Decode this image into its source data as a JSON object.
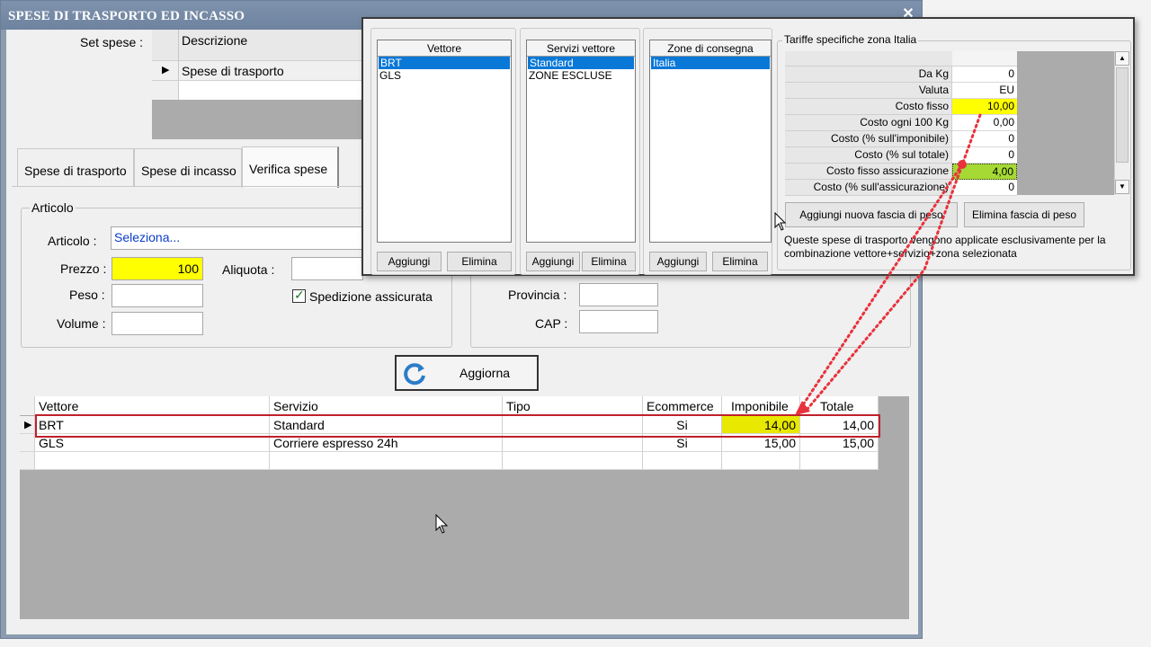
{
  "window": {
    "title": "SPESE DI TRASPORTO ED INCASSO",
    "close_glyph": "✕"
  },
  "set_spese": {
    "label": "Set spese :",
    "column_header": "Descrizione",
    "rows": [
      "Spese di trasporto",
      ""
    ]
  },
  "tabs": [
    "Spese di trasporto",
    "Spese di incasso",
    "Verifica spese"
  ],
  "articolo": {
    "group_title": "Articolo",
    "articolo_label": "Articolo :",
    "articolo_value": "Seleziona...",
    "prezzo_label": "Prezzo :",
    "prezzo_value": "100",
    "aliquota_label": "Aliquota :",
    "aliquota_value": "",
    "peso_label": "Peso :",
    "peso_value": "",
    "volume_label": "Volume :",
    "volume_value": "",
    "spedizione_label": "Spedizione assicurata",
    "spedizione_checked": true
  },
  "destinazione": {
    "provincia_label": "Provincia :",
    "provincia_value": "",
    "cap_label": "CAP :",
    "cap_value": ""
  },
  "aggiorna_button": "Aggiorna",
  "results": {
    "columns": [
      "Vettore",
      "Servizio",
      "Tipo",
      "Ecommerce",
      "Imponibile",
      "Totale"
    ],
    "rows": [
      {
        "vettore": "BRT",
        "servizio": "Standard",
        "tipo": "",
        "ecommerce": "Si",
        "imponibile": "14,00",
        "totale": "14,00"
      },
      {
        "vettore": "GLS",
        "servizio": "Corriere espresso 24h",
        "tipo": "",
        "ecommerce": "Si",
        "imponibile": "15,00",
        "totale": "15,00"
      }
    ]
  },
  "popup": {
    "vettore": {
      "header": "Vettore",
      "items": [
        "BRT",
        "GLS"
      ],
      "selected": "BRT",
      "add": "Aggiungi",
      "remove": "Elimina"
    },
    "servizi": {
      "header": "Servizi vettore",
      "items": [
        "Standard",
        "ZONE ESCLUSE"
      ],
      "selected": "Standard",
      "add": "Aggiungi",
      "remove": "Elimina"
    },
    "zone": {
      "header": "Zone di consegna",
      "items": [
        "Italia"
      ],
      "selected": "Italia",
      "add": "Aggiungi",
      "remove": "Elimina"
    },
    "tariffe": {
      "title": "Tariffe specifiche zona Italia",
      "rows": [
        {
          "key": "Da Kg",
          "value": "0"
        },
        {
          "key": "Valuta",
          "value": "EU"
        },
        {
          "key": "Costo fisso",
          "value": "10,00"
        },
        {
          "key": "Costo ogni 100 Kg",
          "value": "0,00"
        },
        {
          "key": "Costo (% sull'imponibile)",
          "value": "0"
        },
        {
          "key": "Costo (% sul totale)",
          "value": "0"
        },
        {
          "key": "Costo fisso assicurazione",
          "value": "4,00"
        },
        {
          "key": "Costo (% sull'assicurazione)",
          "value": "0"
        }
      ],
      "add_band": "Aggiungi nuova fascia di peso",
      "remove_band": "Elimina fascia di peso",
      "note": "Queste spese di trasporto vengono applicate esclusivamente per la combinazione vettore+servizio+zona selezionata"
    }
  },
  "colors": {
    "highlight_yellow": "#ffff00",
    "highlight_green": "#a6d934",
    "annotation_red": "#e8323c",
    "selection_blue": "#0a78d7"
  }
}
